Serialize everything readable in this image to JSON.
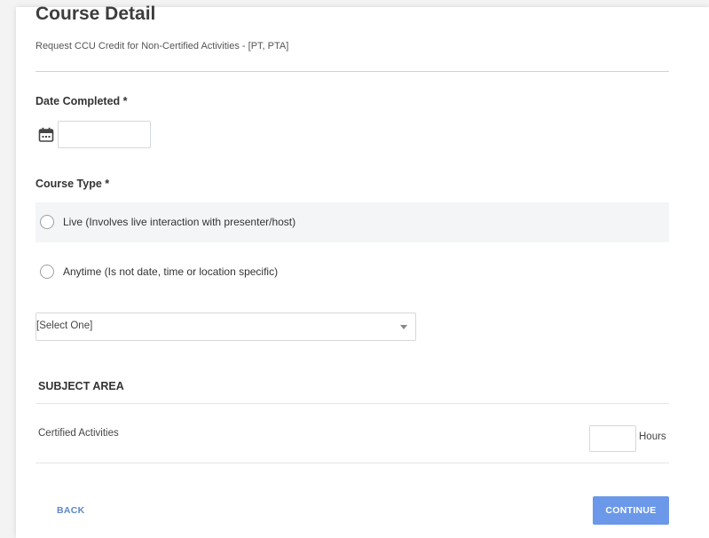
{
  "header": {
    "title": "Course Detail",
    "subtitle": "Request CCU Credit for Non-Certified Activities - [PT, PTA]"
  },
  "date_field": {
    "label": "Date Completed *",
    "value": "",
    "icon": "calendar-icon"
  },
  "course_type": {
    "label": "Course Type *",
    "options": [
      {
        "label": "Live (Involves live interaction with presenter/host)",
        "selected": false
      },
      {
        "label": "Anytime (Is not date, time or location specific)",
        "selected": false
      }
    ]
  },
  "select": {
    "value": "[Select One]",
    "icon": "chevron-down-icon"
  },
  "subject_area": {
    "title": "SUBJECT AREA",
    "rows": [
      {
        "label": "Certified Activities",
        "hours_value": "",
        "unit": "Hours"
      }
    ]
  },
  "actions": {
    "back_label": "BACK",
    "continue_label": "CONTINUE"
  },
  "colors": {
    "accent": "#6b98e8",
    "link": "#5b87c9",
    "row_shade": "#f4f5f7"
  }
}
